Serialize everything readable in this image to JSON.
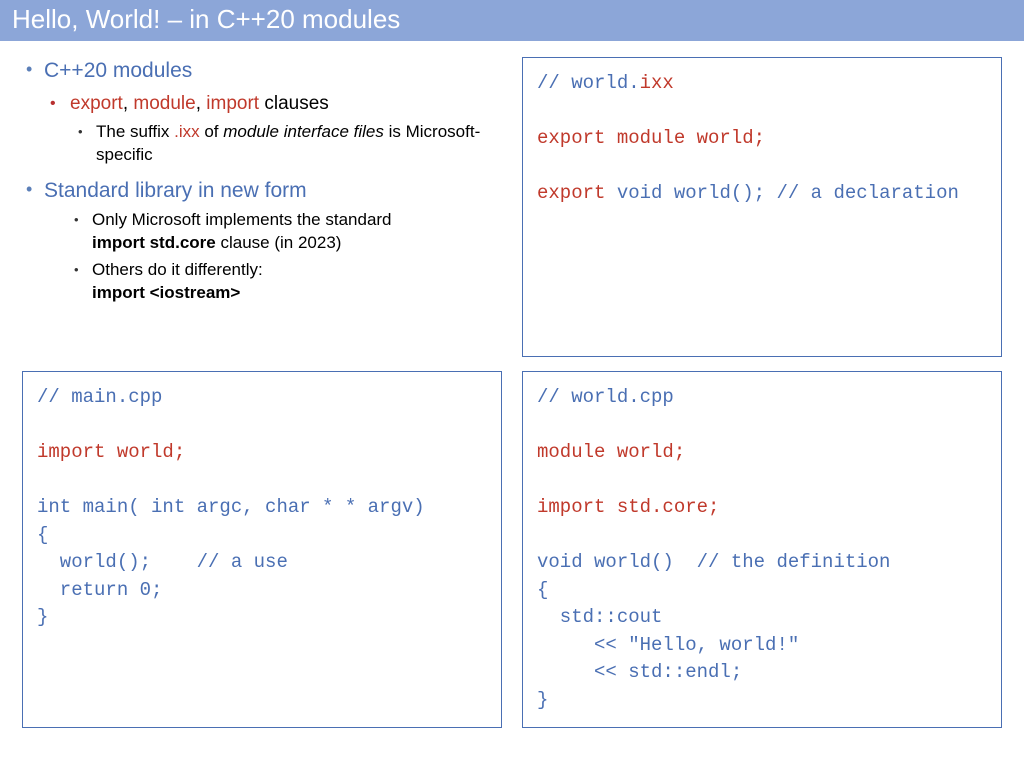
{
  "title": "Hello, World! – in C++20 modules",
  "bullets": {
    "b1_head": "C++20 modules",
    "b1_sub1_pre": "",
    "b1_sub1_kw1": "export",
    "b1_sub1_sep1": ", ",
    "b1_sub1_kw2": "module",
    "b1_sub1_sep2": ", ",
    "b1_sub1_kw3": "import",
    "b1_sub1_post": " clauses",
    "b1_sub1_a_pre": "The suffix ",
    "b1_sub1_a_ixx": ".ixx",
    "b1_sub1_a_mid": " of ",
    "b1_sub1_a_mif": "module interface files",
    "b1_sub1_a_post": " is Microsoft-specific",
    "b2_head": "Standard library in new form",
    "b2_sub1_pre": "Only Microsoft implements the standard ",
    "b2_sub1_bold": "import std.core",
    "b2_sub1_post": " clause (in 2023)",
    "b2_sub2_pre": "Others do it differently:",
    "b2_sub2_bold": "import <iostream>"
  },
  "code_ixx": {
    "l1a": "// world.",
    "l1b": "ixx",
    "l2": "",
    "l3a": "export module world;",
    "l4": "",
    "l5a": "export",
    "l5b": " void world(); // a declaration"
  },
  "code_main": {
    "l1": "// main.cpp",
    "l2": "",
    "l3": "import world;",
    "l4": "",
    "l5": "int main( int argc, char * * argv)",
    "l6": "{",
    "l7": "  world();    // a use",
    "l8": "  return 0;",
    "l9": "}"
  },
  "code_cpp": {
    "l1": "// world.cpp",
    "l2": "",
    "l3": "module world;",
    "l4": "",
    "l5": "import std.core;",
    "l6": "",
    "l7": "void world()  // the definition",
    "l8": "{",
    "l9": "  std::cout",
    "l10": "     << \"Hello, world!\"",
    "l11": "     << std::endl;",
    "l12": "}"
  }
}
